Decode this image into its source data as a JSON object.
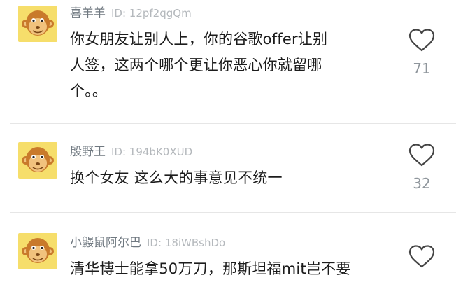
{
  "comments": [
    {
      "username": "喜羊羊",
      "user_id": "ID: 12pf2qgQm",
      "text_lines": [
        "你女朋友让别人上，你的谷歌offer让别",
        "人签，这两个哪个更让你恶心你就留哪",
        "个。。"
      ],
      "likes": "71",
      "avatar_icon": "monkey-avatar-icon",
      "like_icon": "heart-outline-icon"
    },
    {
      "username": "殷野王",
      "user_id": "ID: 194bK0XUD",
      "text_lines": [
        "换个女友 这么大的事意见不统一"
      ],
      "likes": "32",
      "avatar_icon": "monkey-avatar-icon",
      "like_icon": "heart-outline-icon"
    },
    {
      "username": "小鼹鼠阿尔巴",
      "user_id": "ID: 18iWBshDo",
      "text_lines": [
        "清华博士能拿50万刀，那斯坦福mit岂不要"
      ],
      "likes": "",
      "avatar_icon": "monkey-avatar-icon",
      "like_icon": "heart-outline-icon"
    }
  ],
  "colors": {
    "avatar_bg": "#f6de6b",
    "username": "#6f7880",
    "user_id": "#b4b8bc",
    "like_count": "#8f969c"
  }
}
